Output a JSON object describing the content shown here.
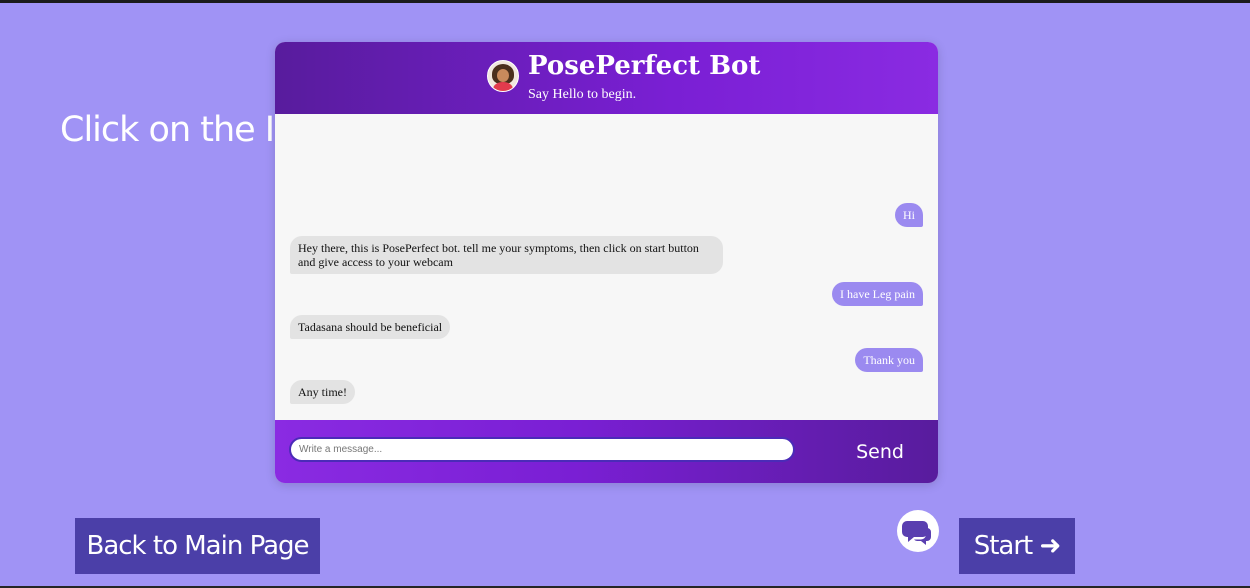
{
  "page": {
    "instruction": "Click on the Ico"
  },
  "chatbot": {
    "title": "PosePerfect Bot",
    "subtitle": "Say Hello to begin.",
    "avatar_icon": "female-avatar-icon",
    "messages": [
      {
        "sender": "user",
        "text": "Hi"
      },
      {
        "sender": "bot",
        "text": "Hey there, this is PosePerfect bot. tell me your symptoms, then click on start button and give access to your webcam"
      },
      {
        "sender": "user",
        "text": "I have Leg pain"
      },
      {
        "sender": "bot",
        "text": "Tadasana should be beneficial"
      },
      {
        "sender": "user",
        "text": "Thank you"
      },
      {
        "sender": "bot",
        "text": "Any time!"
      }
    ],
    "input": {
      "placeholder": "Write a message...",
      "value": ""
    },
    "send_label": "Send"
  },
  "buttons": {
    "back_label": "Back to Main Page",
    "start_label": "Start ➜",
    "chat_toggle_icon": "chat-bubbles-icon"
  },
  "colors": {
    "background": "#a093f5",
    "header_purple": "#7a1fd4",
    "user_bubble": "#9b8af0",
    "bot_bubble": "#e3e3e3",
    "button_bg": "#4b3fa8"
  }
}
